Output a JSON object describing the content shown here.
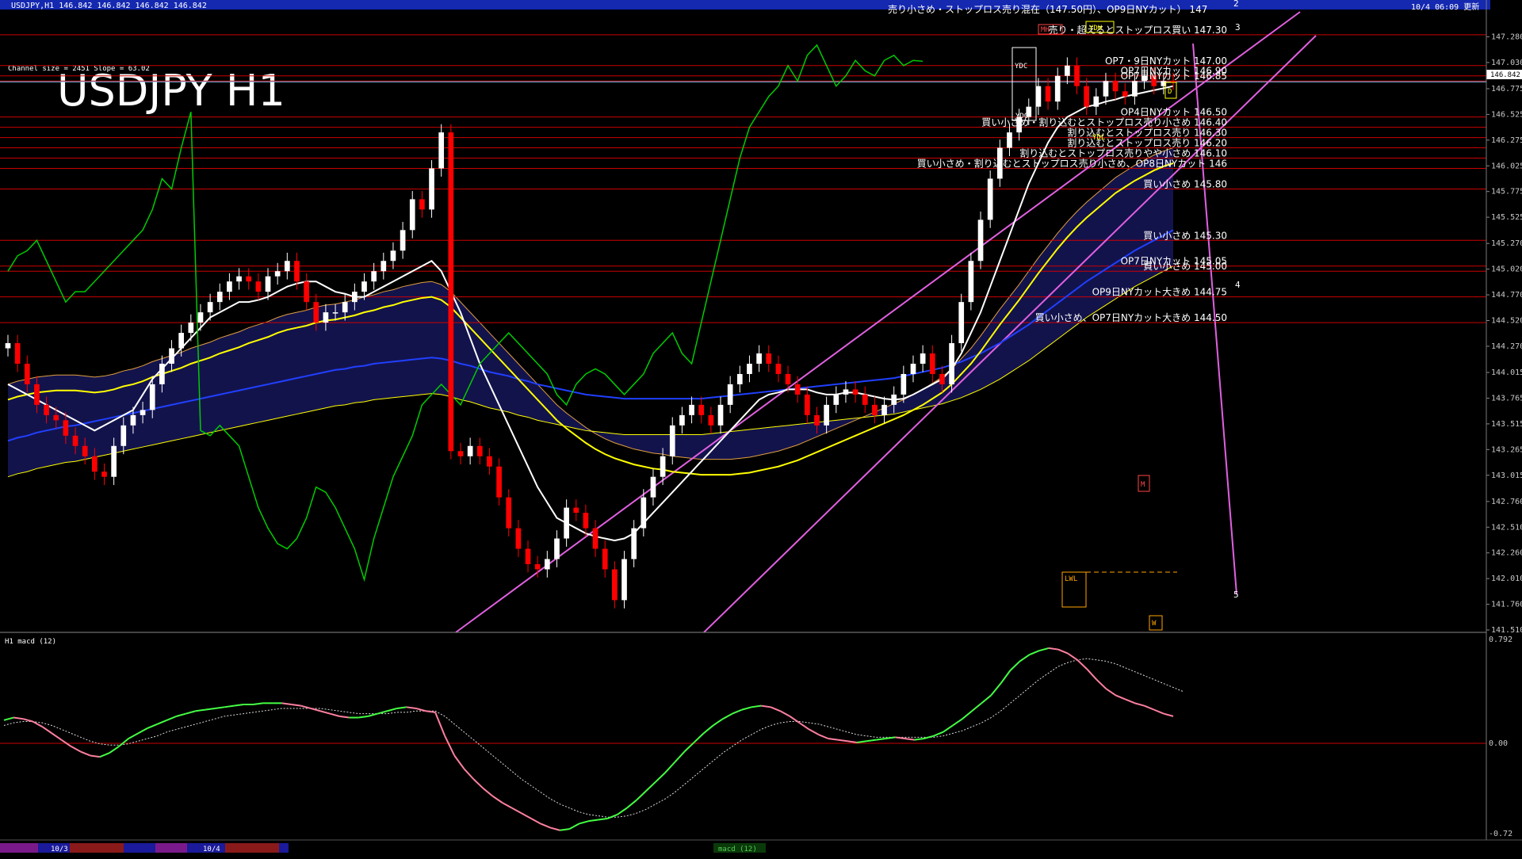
{
  "window": {
    "info_line": "USDJPY,H1  146.842 146.842 146.842 146.842",
    "timestamp": "10/4 06:09 更新",
    "channel_info": "Channel size = 2451 Slope = 63.02",
    "big_title": "USDJPY H1",
    "sub_title": "H1 macd (12)",
    "footer_dates": [
      "10/3",
      "10/4"
    ],
    "footer_tab": "macd (12)"
  },
  "colors": {
    "background": "#000000",
    "bull_candle": "#ffffff",
    "bear_candle": "#ff0000",
    "cloud_bull": "#2a2aa8",
    "cloud_bear": "#c86428",
    "level_line": "#cc0000",
    "channel_line": "#e060e0",
    "sma_white": "#ffffff",
    "sma_yellow": "#ffff00",
    "sma_blue": "#2040ff",
    "chikou": "#00cc00",
    "macd_up": "#44ff44",
    "macd_down": "#ff80a0",
    "current_price_line": "#88ccff"
  },
  "chart_data": {
    "type": "line",
    "symbol": "USDJPY",
    "timeframe": "H1",
    "ylim": [
      141.51,
      147.53
    ],
    "y_ticks": [
      147.28,
      147.03,
      146.775,
      146.525,
      146.275,
      146.025,
      145.775,
      145.525,
      145.27,
      145.02,
      144.77,
      144.52,
      144.27,
      144.015,
      143.765,
      143.515,
      143.265,
      143.015,
      142.76,
      142.51,
      142.26,
      142.01,
      141.76,
      141.51
    ],
    "y_tick_labels": [
      "147.280",
      "147.030",
      "146.775",
      "146.525",
      "146.275",
      "146.025",
      "145.775",
      "145.525",
      "145.270",
      "145.020",
      "144.770",
      "144.520",
      "144.270",
      "144.015",
      "143.765",
      "143.515",
      "143.265",
      "143.015",
      "142.760",
      "142.510",
      "142.260",
      "142.010",
      "141.760",
      "141.510"
    ],
    "current_price": 146.842,
    "current_price_label": "146.842",
    "close_series": [
      144.3,
      144.1,
      143.9,
      143.7,
      143.6,
      143.55,
      143.4,
      143.3,
      143.2,
      143.05,
      143.0,
      143.3,
      143.5,
      143.6,
      143.65,
      143.9,
      144.1,
      144.25,
      144.4,
      144.5,
      144.6,
      144.7,
      144.8,
      144.9,
      144.95,
      144.9,
      144.8,
      144.95,
      145.0,
      145.1,
      144.9,
      144.7,
      144.5,
      144.6,
      144.6,
      144.7,
      144.8,
      144.9,
      145.0,
      145.1,
      145.2,
      145.4,
      145.7,
      145.6,
      146.0,
      146.35,
      143.25,
      143.2,
      143.3,
      143.2,
      143.1,
      142.8,
      142.5,
      142.3,
      142.15,
      142.1,
      142.2,
      142.4,
      142.7,
      142.65,
      142.5,
      142.3,
      142.1,
      141.8,
      142.2,
      142.5,
      142.8,
      143.0,
      143.2,
      143.5,
      143.6,
      143.7,
      143.6,
      143.5,
      143.7,
      143.9,
      144.0,
      144.1,
      144.2,
      144.1,
      144.0,
      143.9,
      143.8,
      143.6,
      143.5,
      143.7,
      143.8,
      143.85,
      143.8,
      143.7,
      143.6,
      143.7,
      143.8,
      144.0,
      144.1,
      144.2,
      144.0,
      143.9,
      144.3,
      144.7,
      145.1,
      145.5,
      145.9,
      146.2,
      146.35,
      146.5,
      146.6,
      146.8,
      146.65,
      146.9,
      147.0,
      146.8,
      146.6,
      146.7,
      146.85,
      146.75,
      146.7,
      146.85,
      146.9,
      146.8,
      146.85,
      146.842
    ],
    "sma_white": [
      143.9,
      143.85,
      143.8,
      143.75,
      143.7,
      143.65,
      143.6,
      143.55,
      143.5,
      143.45,
      143.5,
      143.55,
      143.6,
      143.65,
      143.8,
      143.95,
      144.05,
      144.15,
      144.25,
      144.35,
      144.45,
      144.55,
      144.6,
      144.65,
      144.7,
      144.7,
      144.72,
      144.75,
      144.8,
      144.85,
      144.88,
      144.9,
      144.9,
      144.85,
      144.8,
      144.78,
      144.75,
      144.75,
      144.8,
      144.85,
      144.9,
      144.95,
      145.0,
      145.05,
      145.1,
      145.0,
      144.8,
      144.6,
      144.35,
      144.1,
      143.9,
      143.7,
      143.5,
      143.3,
      143.1,
      142.9,
      142.75,
      142.6,
      142.55,
      142.5,
      142.45,
      142.42,
      142.4,
      142.38,
      142.4,
      142.45,
      142.55,
      142.65,
      142.75,
      142.85,
      142.95,
      143.05,
      143.15,
      143.25,
      143.35,
      143.45,
      143.55,
      143.65,
      143.75,
      143.8,
      143.82,
      143.85,
      143.85,
      143.85,
      143.82,
      143.8,
      143.8,
      143.82,
      143.82,
      143.8,
      143.78,
      143.76,
      143.75,
      143.76,
      143.8,
      143.85,
      143.9,
      143.95,
      144.05,
      144.2,
      144.4,
      144.6,
      144.85,
      145.1,
      145.35,
      145.6,
      145.85,
      146.05,
      146.25,
      146.4,
      146.5,
      146.55,
      146.6,
      146.62,
      146.65,
      146.67,
      146.7,
      146.72,
      146.74,
      146.76,
      146.78,
      146.8
    ],
    "sma_yellow": [
      143.75,
      143.78,
      143.8,
      143.82,
      143.83,
      143.84,
      143.84,
      143.84,
      143.83,
      143.82,
      143.83,
      143.85,
      143.88,
      143.9,
      143.93,
      143.97,
      144.0,
      144.03,
      144.06,
      144.1,
      144.13,
      144.16,
      144.2,
      144.23,
      144.26,
      144.3,
      144.33,
      144.36,
      144.4,
      144.43,
      144.45,
      144.47,
      144.5,
      144.52,
      144.53,
      144.55,
      144.57,
      144.6,
      144.62,
      144.65,
      144.67,
      144.7,
      144.72,
      144.74,
      144.75,
      144.72,
      144.65,
      144.55,
      144.45,
      144.35,
      144.25,
      144.15,
      144.05,
      143.95,
      143.85,
      143.75,
      143.65,
      143.55,
      143.47,
      143.4,
      143.33,
      143.27,
      143.22,
      143.18,
      143.15,
      143.12,
      143.1,
      143.08,
      143.07,
      143.05,
      143.04,
      143.03,
      143.02,
      143.02,
      143.02,
      143.02,
      143.03,
      143.04,
      143.06,
      143.08,
      143.1,
      143.13,
      143.16,
      143.2,
      143.24,
      143.28,
      143.32,
      143.36,
      143.4,
      143.44,
      143.48,
      143.52,
      143.56,
      143.6,
      143.65,
      143.7,
      143.76,
      143.82,
      143.9,
      144.0,
      144.1,
      144.22,
      144.35,
      144.48,
      144.6,
      144.72,
      144.85,
      144.98,
      145.1,
      145.22,
      145.33,
      145.43,
      145.52,
      145.6,
      145.68,
      145.76,
      145.82,
      145.88,
      145.93,
      145.98,
      146.02,
      146.05
    ],
    "sma_blue": [
      143.35,
      143.38,
      143.4,
      143.43,
      143.45,
      143.47,
      143.49,
      143.5,
      143.52,
      143.54,
      143.56,
      143.58,
      143.6,
      143.62,
      143.64,
      143.66,
      143.68,
      143.7,
      143.72,
      143.74,
      143.76,
      143.78,
      143.8,
      143.82,
      143.84,
      143.86,
      143.88,
      143.9,
      143.92,
      143.94,
      143.96,
      143.98,
      144.0,
      144.02,
      144.04,
      144.05,
      144.07,
      144.08,
      144.1,
      144.11,
      144.12,
      144.13,
      144.14,
      144.15,
      144.16,
      144.15,
      144.13,
      144.1,
      144.08,
      144.05,
      144.02,
      144.0,
      143.98,
      143.95,
      143.93,
      143.9,
      143.88,
      143.86,
      143.84,
      143.82,
      143.8,
      143.79,
      143.78,
      143.77,
      143.76,
      143.76,
      143.76,
      143.76,
      143.76,
      143.76,
      143.76,
      143.76,
      143.76,
      143.77,
      143.78,
      143.79,
      143.8,
      143.81,
      143.82,
      143.83,
      143.84,
      143.85,
      143.86,
      143.87,
      143.88,
      143.89,
      143.9,
      143.91,
      143.92,
      143.93,
      143.94,
      143.95,
      143.96,
      143.98,
      144.0,
      144.02,
      144.04,
      144.06,
      144.09,
      144.12,
      144.16,
      144.2,
      144.25,
      144.3,
      144.36,
      144.42,
      144.48,
      144.55,
      144.62,
      144.69,
      144.76,
      144.83,
      144.9,
      144.96,
      145.02,
      145.08,
      145.14,
      145.2,
      145.25,
      145.3,
      145.35,
      145.4
    ],
    "levels": [
      {
        "price": 147.3,
        "label": "売り・超えるとストップロス買い 147.30"
      },
      {
        "price": 147.0,
        "label": "OP7・9日NYカット 147.00"
      },
      {
        "price": 146.9,
        "label": "OP7日NYカット 146.90"
      },
      {
        "price": 146.85,
        "label": "OP7日NYカット 146.85"
      },
      {
        "price": 146.5,
        "label": "OP4日NYカット 146.50"
      },
      {
        "price": 146.4,
        "label": "買い小さめ・割り込むとストップロス売り小さめ 146.40"
      },
      {
        "price": 146.3,
        "label": "割り込むとストップロス売り 146.30"
      },
      {
        "price": 146.2,
        "label": "割り込むとストップロス売り 146.20"
      },
      {
        "price": 146.1,
        "label": "割り込むとストップロス売りやや小さめ 146.10"
      },
      {
        "price": 146.0,
        "label": "買い小さめ・割り込むとストップロス売り小さめ、OP8日NYカット 146"
      },
      {
        "price": 145.8,
        "label": "買い小さめ 145.80"
      },
      {
        "price": 145.3,
        "label": "買い小さめ 145.30"
      },
      {
        "price": 145.05,
        "label": "OP7日NYカット 145.05"
      },
      {
        "price": 145.0,
        "label": "買い小さめ 145.00"
      },
      {
        "price": 144.75,
        "label": "OP9日NYカット大きめ 144.75"
      },
      {
        "price": 144.5,
        "label": "買い小さめ、OP7日NYカット大きめ 144.50"
      }
    ],
    "top_annotation": "売り小さめ・ストップロス売り混在（147.50円）、OP9日NYカット） 147",
    "wave_labels": [
      "2",
      "3",
      "4",
      "5"
    ],
    "box_labels": [
      "YDC",
      "YDO",
      "YDH",
      "YDL",
      "MH",
      "M",
      "W",
      "D",
      "LWL"
    ],
    "macd": {
      "ylim": [
        -0.72,
        0.792
      ],
      "tick_labels": [
        "0.792",
        "0.00",
        "-0.72"
      ],
      "macd": [
        0.17,
        0.19,
        0.18,
        0.16,
        0.12,
        0.07,
        0.02,
        -0.03,
        -0.07,
        -0.1,
        -0.11,
        -0.08,
        -0.03,
        0.03,
        0.07,
        0.11,
        0.14,
        0.17,
        0.2,
        0.22,
        0.24,
        0.25,
        0.26,
        0.27,
        0.28,
        0.29,
        0.29,
        0.3,
        0.3,
        0.3,
        0.29,
        0.28,
        0.26,
        0.24,
        0.22,
        0.2,
        0.19,
        0.19,
        0.2,
        0.22,
        0.24,
        0.26,
        0.27,
        0.26,
        0.24,
        0.23,
        0.05,
        -0.1,
        -0.2,
        -0.28,
        -0.35,
        -0.41,
        -0.46,
        -0.5,
        -0.54,
        -0.58,
        -0.62,
        -0.65,
        -0.67,
        -0.66,
        -0.62,
        -0.6,
        -0.59,
        -0.58,
        -0.55,
        -0.5,
        -0.44,
        -0.37,
        -0.3,
        -0.23,
        -0.15,
        -0.07,
        0.0,
        0.07,
        0.13,
        0.18,
        0.22,
        0.25,
        0.27,
        0.28,
        0.27,
        0.24,
        0.2,
        0.15,
        0.1,
        0.06,
        0.03,
        0.02,
        0.01,
        0.0,
        0.01,
        0.02,
        0.03,
        0.04,
        0.03,
        0.02,
        0.03,
        0.05,
        0.08,
        0.13,
        0.18,
        0.24,
        0.3,
        0.36,
        0.45,
        0.55,
        0.62,
        0.67,
        0.7,
        0.72,
        0.71,
        0.68,
        0.63,
        0.56,
        0.48,
        0.41,
        0.36,
        0.33,
        0.3,
        0.28,
        0.25,
        0.22,
        0.2
      ],
      "signal": [
        0.13,
        0.15,
        0.16,
        0.16,
        0.15,
        0.13,
        0.1,
        0.07,
        0.04,
        0.01,
        -0.01,
        -0.02,
        -0.02,
        -0.01,
        0.01,
        0.03,
        0.05,
        0.08,
        0.1,
        0.12,
        0.14,
        0.16,
        0.18,
        0.2,
        0.21,
        0.22,
        0.23,
        0.24,
        0.25,
        0.26,
        0.26,
        0.26,
        0.26,
        0.26,
        0.25,
        0.24,
        0.23,
        0.22,
        0.22,
        0.22,
        0.22,
        0.23,
        0.23,
        0.24,
        0.24,
        0.24,
        0.2,
        0.14,
        0.08,
        0.02,
        -0.04,
        -0.1,
        -0.16,
        -0.22,
        -0.28,
        -0.33,
        -0.38,
        -0.43,
        -0.47,
        -0.5,
        -0.53,
        -0.55,
        -0.56,
        -0.57,
        -0.57,
        -0.56,
        -0.54,
        -0.51,
        -0.47,
        -0.43,
        -0.38,
        -0.32,
        -0.26,
        -0.2,
        -0.14,
        -0.08,
        -0.03,
        0.02,
        0.06,
        0.1,
        0.13,
        0.15,
        0.16,
        0.16,
        0.15,
        0.14,
        0.12,
        0.1,
        0.08,
        0.06,
        0.05,
        0.04,
        0.04,
        0.04,
        0.04,
        0.04,
        0.04,
        0.04,
        0.05,
        0.07,
        0.09,
        0.12,
        0.15,
        0.19,
        0.24,
        0.3,
        0.36,
        0.42,
        0.48,
        0.53,
        0.58,
        0.61,
        0.63,
        0.64,
        0.63,
        0.62,
        0.6,
        0.57,
        0.54,
        0.51,
        0.48,
        0.45,
        0.42,
        0.39
      ]
    }
  }
}
